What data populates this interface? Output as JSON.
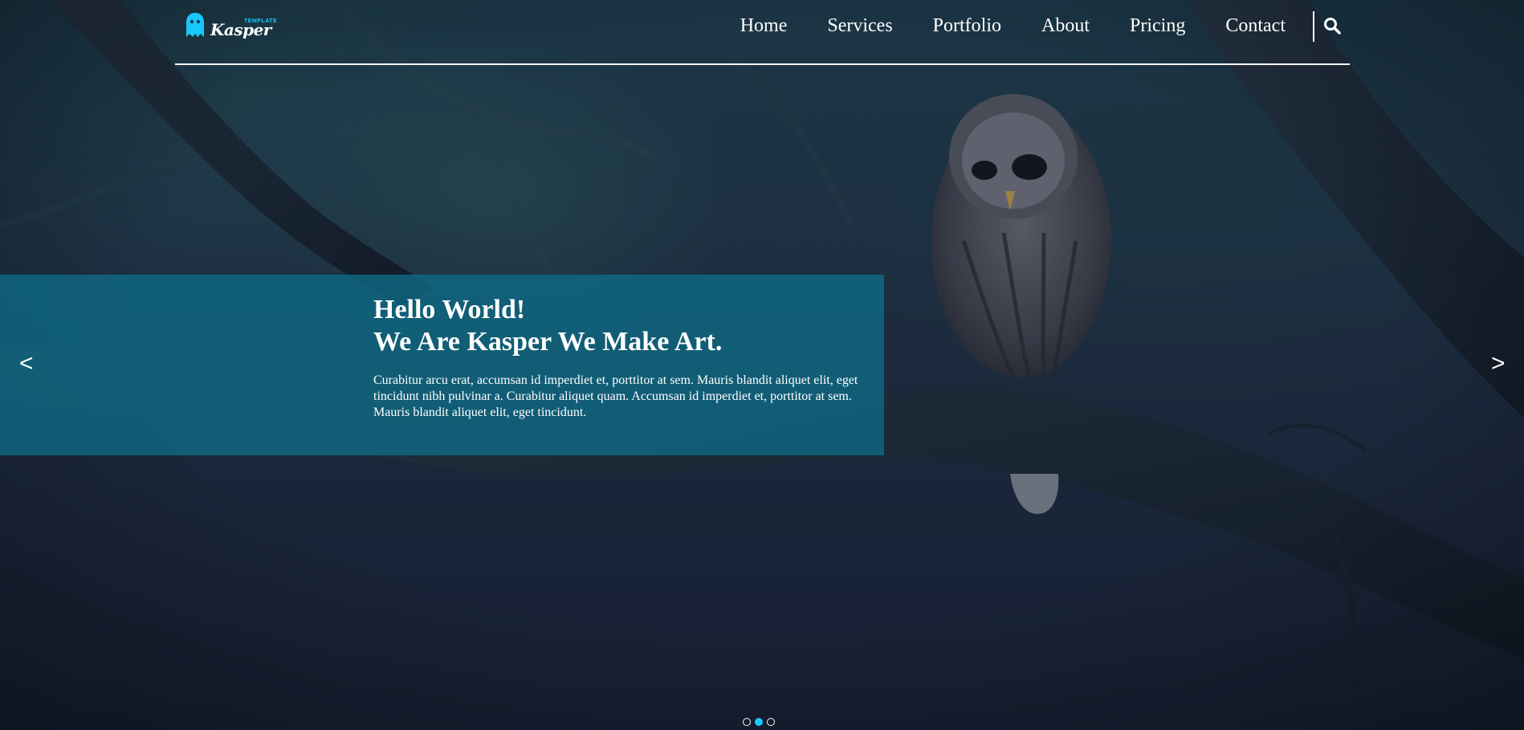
{
  "logo": {
    "small_text": "TEMPLATE",
    "word": "Kasper"
  },
  "nav": {
    "items": [
      {
        "label": "Home"
      },
      {
        "label": "Services"
      },
      {
        "label": "Portfolio"
      },
      {
        "label": "About"
      },
      {
        "label": "Pricing"
      },
      {
        "label": "Contact"
      }
    ],
    "search_icon": "search-icon"
  },
  "slider": {
    "title_line1": "Hello World!",
    "title_line2": "We Are Kasper We Make Art.",
    "text": "Curabitur arcu erat, accumsan id imperdiet et, porttitor at sem. Mauris blandit aliquet elit, eget tincidunt nibh pulvinar a. Curabitur aliquet quam. Accumsan id imperdiet et, porttitor at sem. Mauris blandit aliquet elit, eget tincidunt.",
    "prev": "<",
    "next": ">",
    "bullets": [
      {
        "active": false
      },
      {
        "active": true
      },
      {
        "active": false
      }
    ]
  },
  "colors": {
    "accent": "#19c8fa",
    "overlay": "#0e6c87"
  }
}
